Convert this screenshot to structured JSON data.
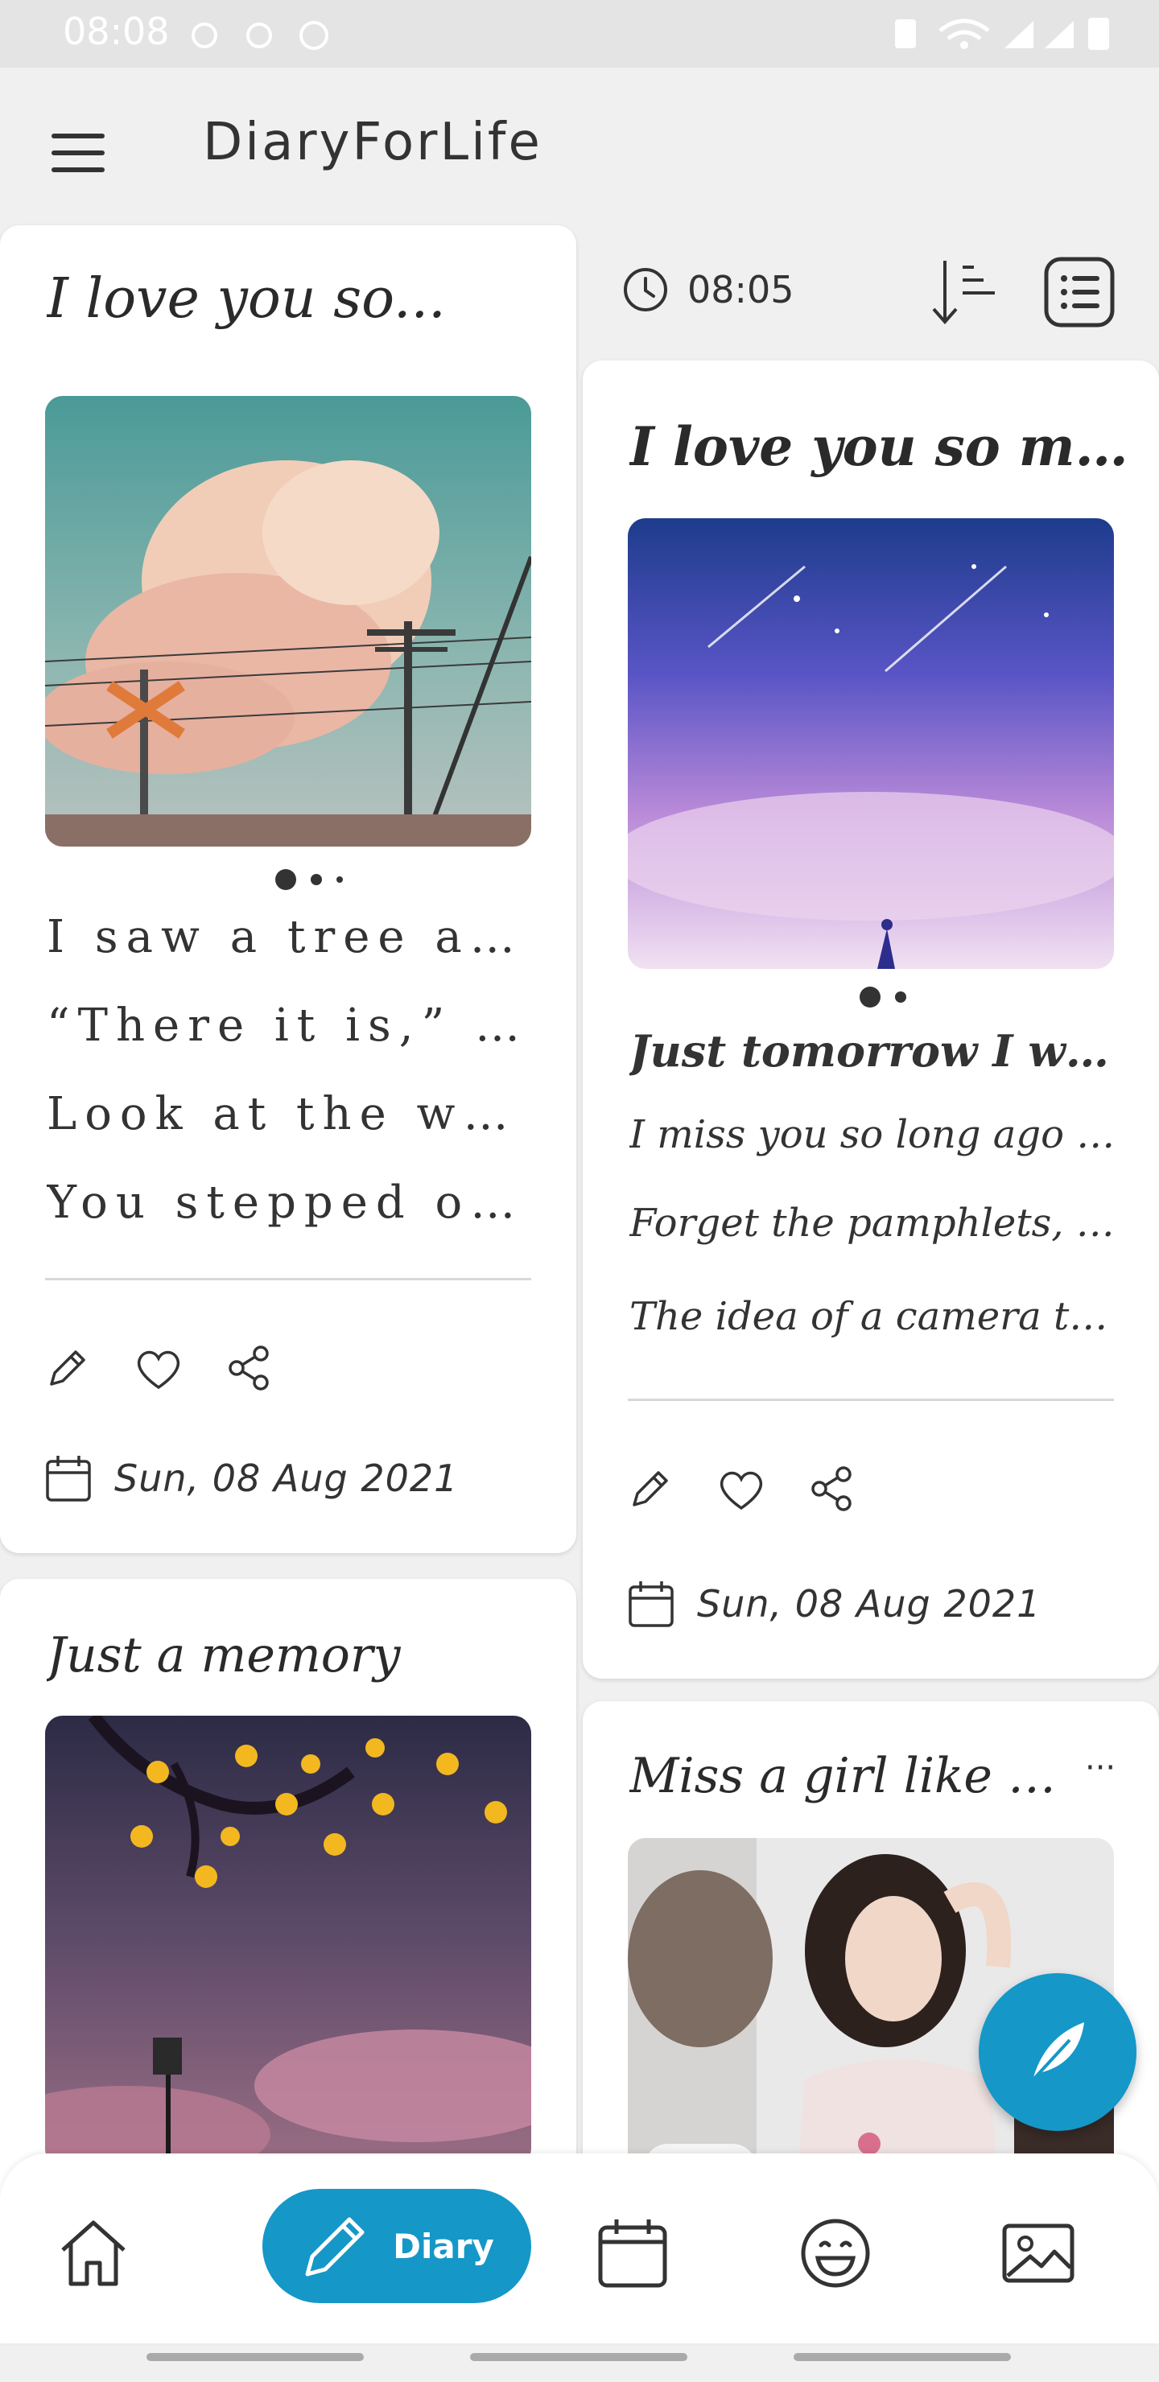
{
  "status_bar": {
    "time": "08:08"
  },
  "app_bar": {
    "title": "DiaryForLife",
    "menu_icon": "hamburger-menu-icon"
  },
  "toolbar": {
    "time": "08:05",
    "icons": [
      "clock-icon",
      "sort-icon",
      "list-view-icon"
    ]
  },
  "cards": [
    {
      "title": "I love you so...",
      "image_count": 3,
      "active_image": 1,
      "lines": [
        "I saw a tree an...",
        "“There it is,” yo...",
        "Look at the way..",
        "You stepped ove..."
      ],
      "date": "Sun, 08 Aug 2021"
    },
    {
      "title": "I love you so mu...",
      "image_count": 2,
      "active_image": 1,
      "lines": [
        "Just tomorrow I will go...",
        "I miss you so long ago ....",
        "Forget the pamphlets, yo...",
        "The idea of a camera ta..."
      ],
      "date": "Sun, 08 Aug 2021"
    },
    {
      "title": "Just a memory"
    },
    {
      "title": "Miss a girl like you...",
      "more_label": "···"
    }
  ],
  "bottom_nav": {
    "items": [
      "home-icon",
      "diary",
      "calendar-icon",
      "mood-icon",
      "gallery-icon"
    ],
    "diary_label": "Diary"
  },
  "colors": {
    "accent": "#1597c8",
    "background": "#f0f0f0"
  }
}
